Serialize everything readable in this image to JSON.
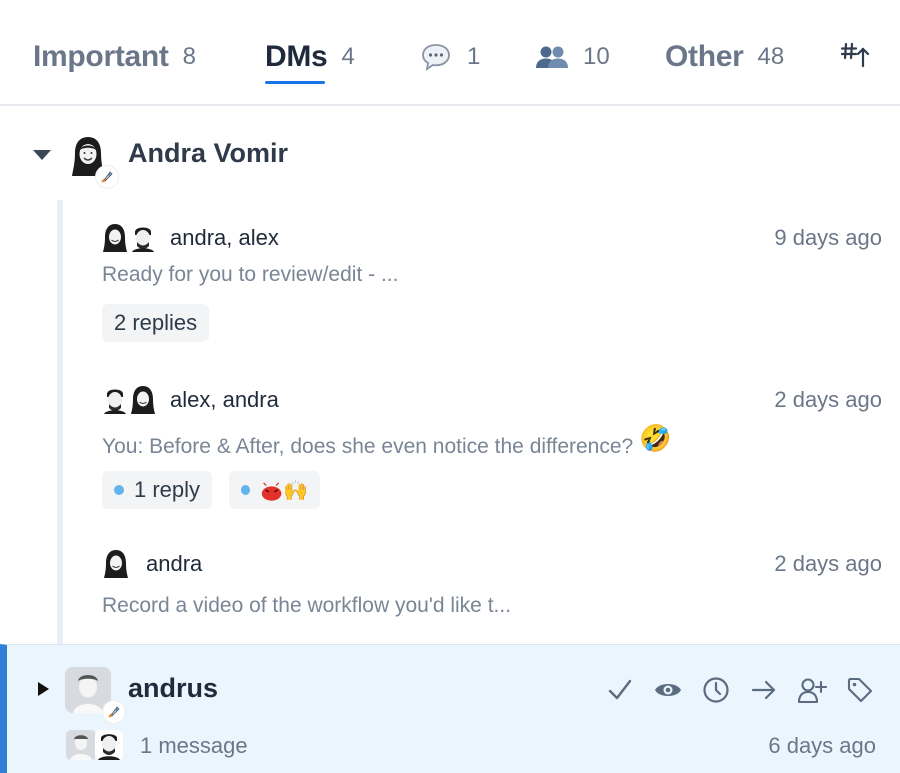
{
  "tabs": [
    {
      "label": "Important",
      "count": "8"
    },
    {
      "label": "DMs",
      "count": "4"
    },
    {
      "icon": "speech-bubble-icon",
      "count": "1"
    },
    {
      "icon": "people-icon",
      "count": "10"
    },
    {
      "label": "Other",
      "count": "48"
    }
  ],
  "sort_icon": "hash-sort-up-icon",
  "group": {
    "name": "Andra Vomir",
    "badge_icon": "rocket-icon"
  },
  "threads": [
    {
      "participants": "andra, alex",
      "time": "9 days ago",
      "snippet": "Ready for you to review/edit - ...",
      "chips": [
        "2 replies"
      ]
    },
    {
      "participants": "alex, andra",
      "time": "2 days ago",
      "snippet": "You: Before & After, does she even notice the difference? ",
      "emoji": "🤣",
      "chips": [
        "1 reply"
      ],
      "reaction_emoji": "🙌"
    },
    {
      "participants": "andra",
      "time": "2 days ago",
      "snippet": "Record a video of the workflow you'd like t..."
    }
  ],
  "selected": {
    "name": "andrus",
    "subtext": "1 message",
    "time": "6 days ago",
    "actions": [
      "check-icon",
      "eye-icon",
      "clock-icon",
      "arrow-right-icon",
      "add-user-icon",
      "tag-icon"
    ]
  },
  "colors": {
    "accent": "#1a73e8",
    "selected_bg": "#eaf5fd",
    "selected_border": "#2f80d6",
    "unread_dot": "#63b3ed"
  }
}
